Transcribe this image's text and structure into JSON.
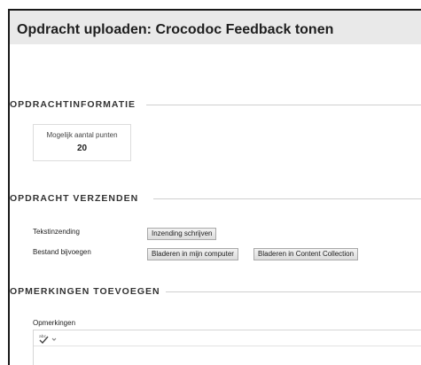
{
  "page": {
    "title": "Opdracht uploaden: Crocodoc Feedback tonen"
  },
  "sections": {
    "info": {
      "heading": "OPDRACHTINFORMATIE",
      "points_label": "Mogelijk aantal punten",
      "points_value": "20"
    },
    "submit": {
      "heading": "OPDRACHT VERZENDEN",
      "text_submission_label": "Tekstinzending",
      "write_submission_button": "Inzending schrijven",
      "attach_file_label": "Bestand bijvoegen",
      "browse_computer_button": "Bladeren in mijn computer",
      "browse_content_collection_button": "Bladeren in Content Collection"
    },
    "comments": {
      "heading": "OPMERKINGEN TOEVOEGEN",
      "comments_label": "Opmerkingen"
    }
  },
  "icons": {
    "spellcheck": "spellcheck-icon",
    "dropdown": "chevron-down-icon"
  }
}
